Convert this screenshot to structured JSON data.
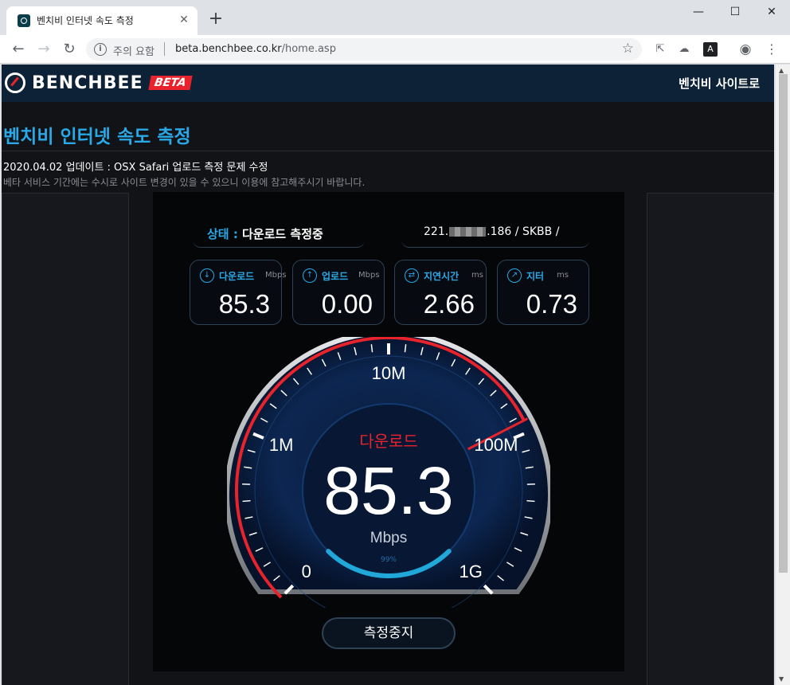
{
  "browser": {
    "tab_title": "벤치비 인터넷 속도 측정",
    "tab_close": "✕",
    "new_tab": "+",
    "window_controls": {
      "minimize": "—",
      "maximize": "☐",
      "close": "✕"
    },
    "security_label": "주의 요함",
    "url_host": "beta.benchbee.co.kr",
    "url_path": "/home.asp"
  },
  "header": {
    "logo_text": "BENCHBEE",
    "logo_badge": "BETA",
    "site_link": "벤치비 사이트로"
  },
  "page": {
    "title": "벤치비 인터넷 속도 측정",
    "update": "2020.04.02 업데이트 : OSX Safari 업로드 측정 문제 수정",
    "notice": "베타 서비스 기간에는 수시로 사이트 변경이 있을 수 있으니 이용에 참고해주시기 바랍니다."
  },
  "status": {
    "label": "상태 :",
    "value": "다운로드 측정중",
    "ip_prefix": "221.",
    "ip_suffix": ".186 / SKBB /"
  },
  "stats": [
    {
      "name": "다운로드",
      "unit": "Mbps",
      "value": "85.3",
      "icon": "download-icon"
    },
    {
      "name": "업로드",
      "unit": "Mbps",
      "value": "0.00",
      "icon": "upload-icon"
    },
    {
      "name": "지연시간",
      "unit": "ms",
      "value": "2.66",
      "icon": "latency-icon"
    },
    {
      "name": "지터",
      "unit": "ms",
      "value": "0.73",
      "icon": "jitter-icon"
    }
  ],
  "gauge": {
    "mode": "다운로드",
    "value": "85.3",
    "unit": "Mbps",
    "progress_text": "99%",
    "progress": 0.99,
    "scale_labels": [
      "0",
      "1M",
      "10M",
      "100M",
      "1G"
    ],
    "accent_color": "#e8232b",
    "ring_color": "#1fa8d8"
  },
  "controls": {
    "stop_label": "측정중지"
  }
}
